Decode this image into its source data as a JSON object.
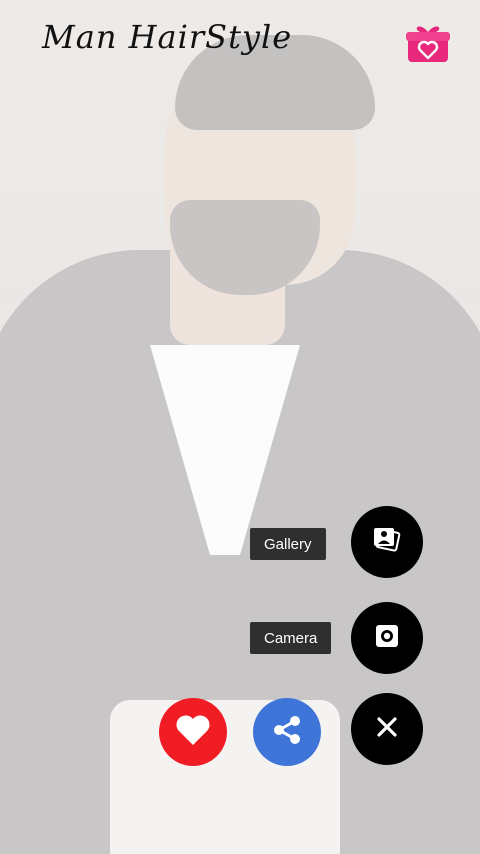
{
  "app": {
    "title": "Man HairStyle"
  },
  "menu": {
    "gallery_label": "Gallery",
    "camera_label": "Camera"
  },
  "icons": {
    "gift": "gift-icon",
    "gallery": "photo-gallery-icon",
    "camera": "camera-icon",
    "heart": "heart-icon",
    "share": "share-icon",
    "close": "close-icon"
  },
  "colors": {
    "gift": "#e8287a",
    "heart_button": "#f01d25",
    "share_button": "#3f74d9",
    "fab_dark": "#000000",
    "chip_bg": "#2f2f2f"
  }
}
